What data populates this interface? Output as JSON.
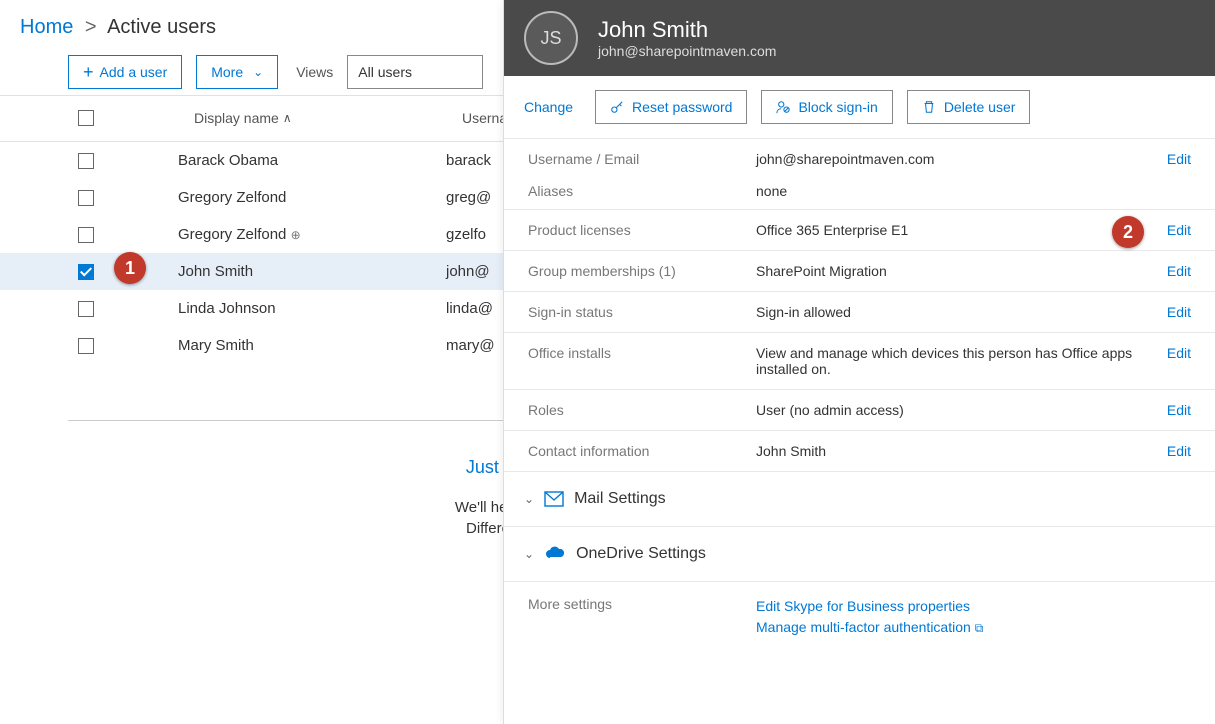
{
  "breadcrumb": {
    "home": "Home",
    "current": "Active users"
  },
  "toolbar": {
    "add_user": "Add a user",
    "more": "More",
    "views_label": "Views",
    "views_value": "All users"
  },
  "columns": {
    "display_name": "Display name",
    "username": "Username"
  },
  "users": [
    {
      "name": "Barack Obama",
      "username": "barack",
      "checked": false,
      "special": false
    },
    {
      "name": "Gregory Zelfond",
      "username": "greg@",
      "checked": false,
      "special": false
    },
    {
      "name": "Gregory Zelfond",
      "username": "gzelfo",
      "checked": false,
      "special": true
    },
    {
      "name": "John Smith",
      "username": "john@",
      "checked": true,
      "special": false
    },
    {
      "name": "Linda Johnson",
      "username": "linda@",
      "checked": false,
      "special": false
    },
    {
      "name": "Mary Smith",
      "username": "mary@",
      "checked": false,
      "special": false
    }
  ],
  "helper": {
    "title": "Just want to add an email address?",
    "text": "We'll help you select the right option based on your needs.",
    "different": "Different"
  },
  "panel": {
    "initials": "JS",
    "name": "John Smith",
    "email": "john@sharepointmaven.com",
    "change": "Change",
    "actions": {
      "reset": "Reset password",
      "block": "Block sign-in",
      "delete": "Delete user"
    },
    "props": {
      "username_label": "Username / Email",
      "username_val": "john@sharepointmaven.com",
      "aliases_label": "Aliases",
      "aliases_val": "none",
      "licenses_label": "Product licenses",
      "licenses_val": "Office 365 Enterprise E1",
      "groups_label": "Group memberships (1)",
      "groups_val": "SharePoint Migration",
      "signin_label": "Sign-in status",
      "signin_val": "Sign-in allowed",
      "office_label": "Office installs",
      "office_val": "View and manage which devices this person has Office apps installed on.",
      "roles_label": "Roles",
      "roles_val": "User (no admin access)",
      "contact_label": "Contact information",
      "contact_val": "John Smith"
    },
    "edit": "Edit",
    "sections": {
      "mail": "Mail Settings",
      "onedrive": "OneDrive Settings"
    },
    "more": {
      "label": "More settings",
      "skype": "Edit Skype for Business properties",
      "mfa": "Manage multi-factor authentication"
    }
  },
  "badges": {
    "one": "1",
    "two": "2"
  }
}
